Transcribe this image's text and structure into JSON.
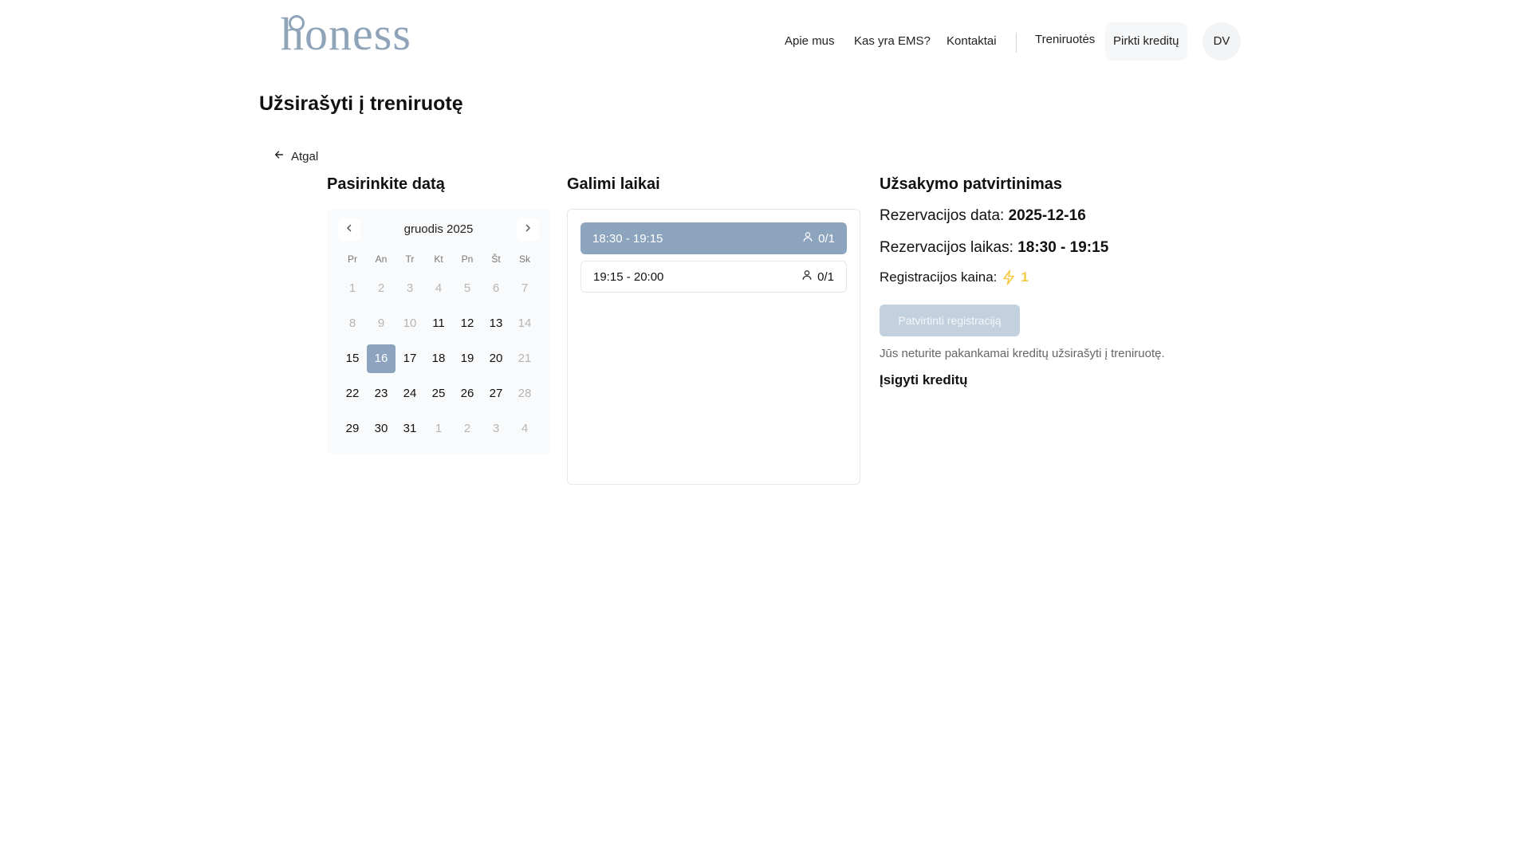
{
  "header": {
    "logo_text": "honess",
    "nav": {
      "about": "Apie mus",
      "ems": "Kas yra EMS?",
      "contacts": "Kontaktai",
      "trainings": "Treniruotės",
      "buy_credits": "Pirkti kreditų"
    },
    "avatar_initials": "DV"
  },
  "page_title": "Užsirašyti į treniruotę",
  "back_label": "Atgal",
  "calendar": {
    "section_title": "Pasirinkite datą",
    "month_label": "gruodis 2025",
    "weekdays": [
      "Pr",
      "An",
      "Tr",
      "Kt",
      "Pn",
      "Št",
      "Sk"
    ],
    "selected_day": "16",
    "weeks": [
      [
        "1",
        "2",
        "3",
        "4",
        "5",
        "6",
        "7"
      ],
      [
        "8",
        "9",
        "10",
        "11",
        "12",
        "13",
        "14"
      ],
      [
        "15",
        "16",
        "17",
        "18",
        "19",
        "20",
        "21"
      ],
      [
        "22",
        "23",
        "24",
        "25",
        "26",
        "27",
        "28"
      ],
      [
        "29",
        "30",
        "31",
        "1",
        "2",
        "3",
        "4"
      ]
    ]
  },
  "times": {
    "section_title": "Galimi laikai",
    "slots": [
      {
        "label": "18:30 - 19:15",
        "capacity": "0/1",
        "selected": true
      },
      {
        "label": "19:15 - 20:00",
        "capacity": "0/1",
        "selected": false
      }
    ]
  },
  "confirmation": {
    "section_title": "Užsakymo patvirtinimas",
    "date_label": "Rezervacijos data:",
    "date_value": "2025-12-16",
    "time_label": "Rezervacijos laikas:",
    "time_value": "18:30 - 19:15",
    "price_label": "Registracijos kaina:",
    "price_value": "1",
    "confirm_button": "Patvirtinti registraciją",
    "warning": "Jūs neturite pakankamai kreditų užsirašyti į treniruotę.",
    "buy_link": "Įsigyti kreditų"
  },
  "colors": {
    "accent": "#8ca4bd",
    "disabled_button": "#c3d0dd",
    "credit_bolt": "#f5c842"
  }
}
